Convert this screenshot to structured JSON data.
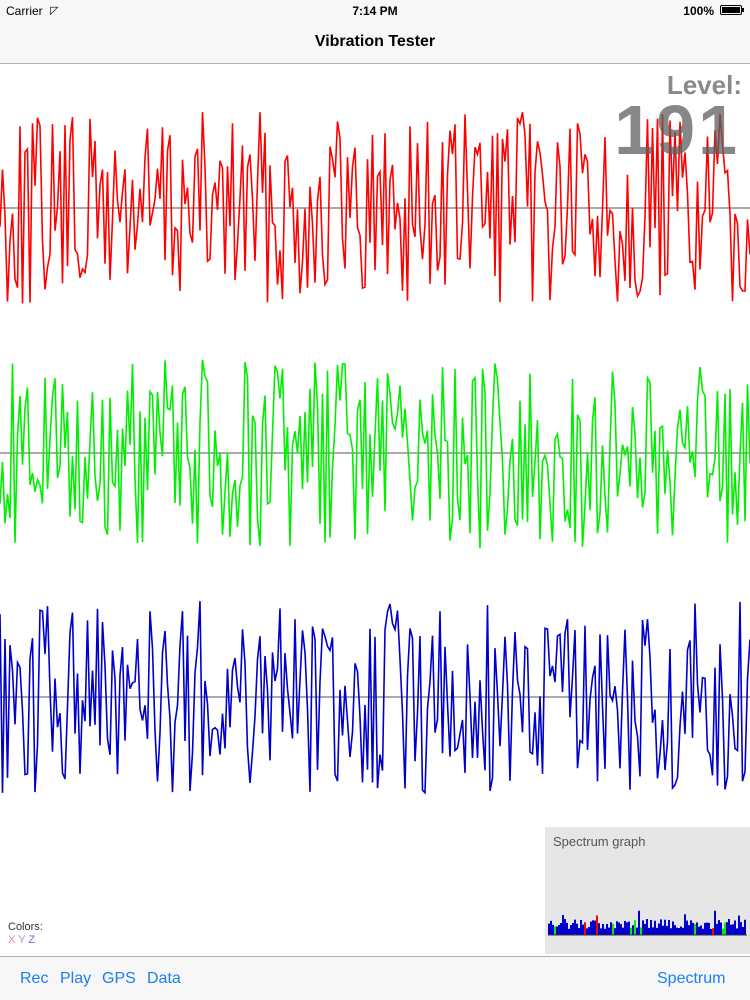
{
  "status": {
    "carrier": "Carrier",
    "time": "7:14 PM",
    "battery": "100%"
  },
  "nav": {
    "title": "Vibration Tester"
  },
  "level": {
    "label": "Level:",
    "value": "191"
  },
  "legend": {
    "title": "Colors:",
    "x": "X",
    "y": "Y",
    "z": "Z"
  },
  "spectrum": {
    "title": "Spectrum graph"
  },
  "toolbar": {
    "rec": "Rec",
    "play": "Play",
    "gps": "GPS",
    "data": "Data",
    "spectrum": "Spectrum"
  },
  "colors": {
    "x": "#ff0000",
    "y": "#00ee00",
    "z": "#0000cc",
    "accent": "#1a7ff0"
  }
}
